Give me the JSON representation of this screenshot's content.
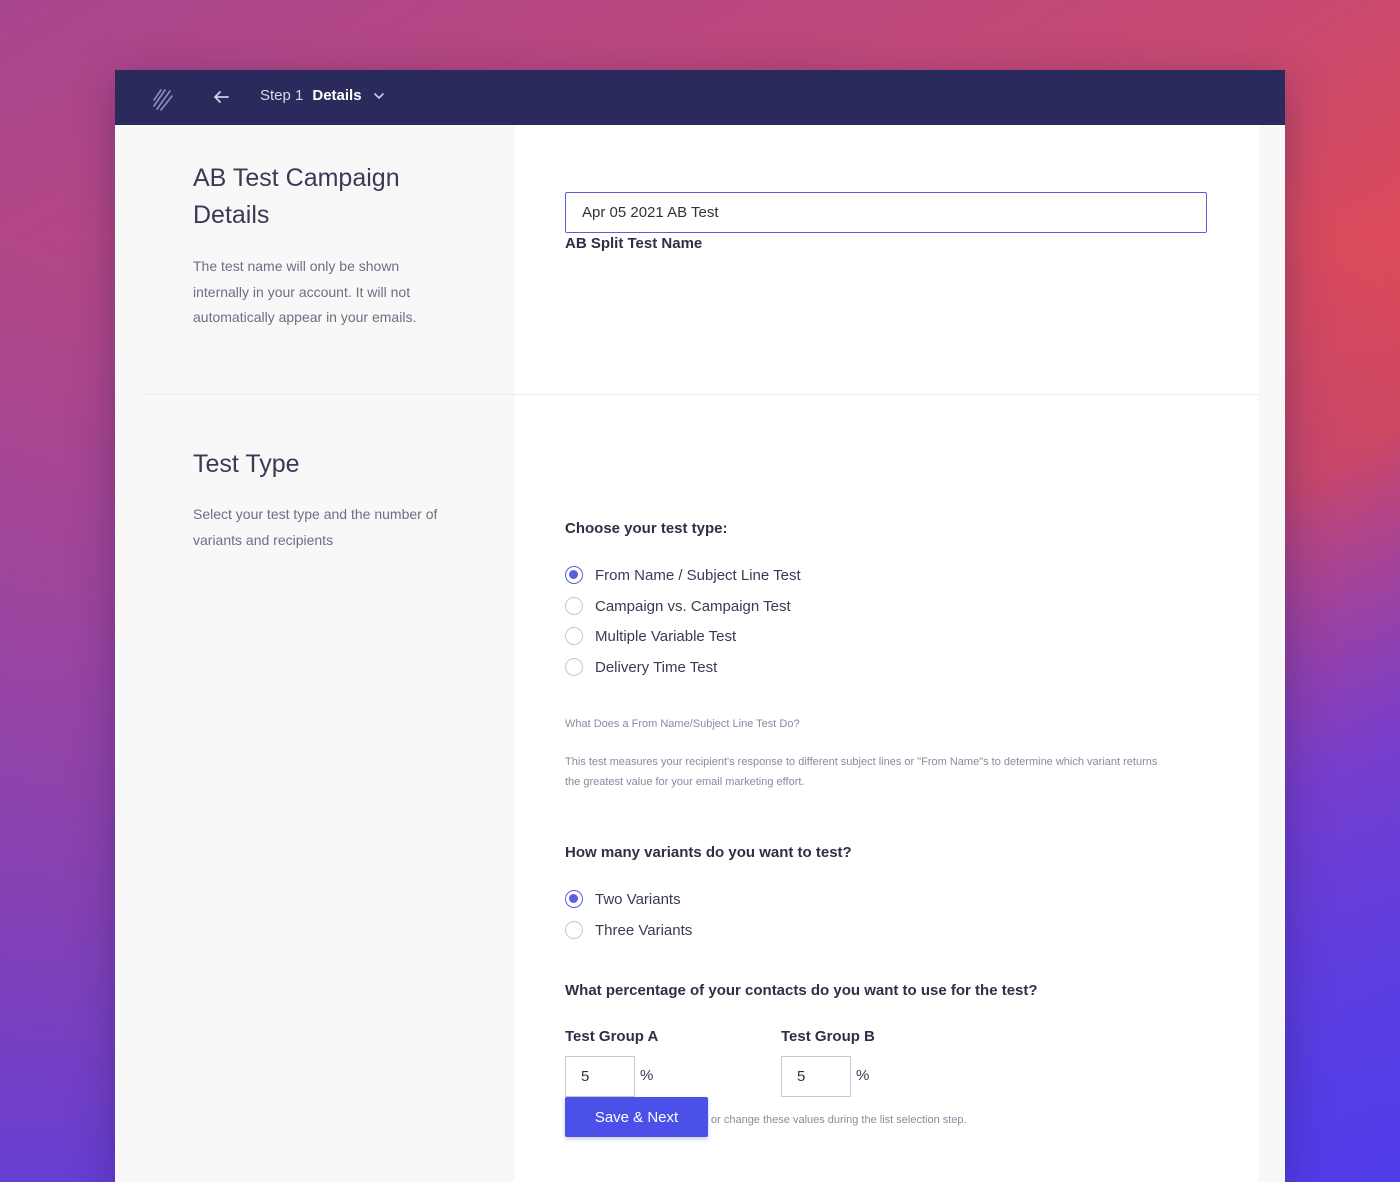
{
  "topbar": {
    "step_label": "Step 1",
    "current_step": "Details"
  },
  "details": {
    "title_line1": "AB Test Campaign",
    "title_line2": "Details",
    "description_line1": "The test name will only be shown",
    "description_line2": "internally in your account. It will not",
    "description_line3": "automatically appear in your emails.",
    "name_label": "AB Split Test Name",
    "name_value": "Apr 05 2021 AB Test"
  },
  "test_type": {
    "title": "Test Type",
    "description_line1": "Select your test type and the number of",
    "description_line2": "variants and recipients",
    "choose_label": "Choose your test type:",
    "options": [
      {
        "label": "From Name / Subject Line Test",
        "checked": true
      },
      {
        "label": "Campaign vs. Campaign Test",
        "checked": false
      },
      {
        "label": "Multiple Variable Test",
        "checked": false
      },
      {
        "label": "Delivery Time Test",
        "checked": false
      }
    ],
    "help_title": "What Does a From Name/Subject Line Test Do?",
    "help_text_line1": "This test measures your recipient's response to different subject lines or \"From Name\"s to determine which variant returns",
    "help_text_line2": "the greatest value for your email marketing effort.",
    "variants_label": "How many variants do you want to test?",
    "variants": [
      {
        "label": "Two Variants",
        "checked": true
      },
      {
        "label": "Three Variants",
        "checked": false
      }
    ],
    "percentage_label": "What percentage of your contacts do you want to use for the test?",
    "group_a_label": "Test Group A",
    "group_a_value": "5",
    "group_b_label": "Test Group B",
    "group_b_value": "5",
    "percent_symbol": "%",
    "note": "You'll get a chance to confirm or change these values during the list selection step."
  },
  "actions": {
    "save_label": "Save & Next"
  },
  "colors": {
    "topbar": "#2b2a5c",
    "accent": "#5b5ee0",
    "button": "#4b50e8"
  }
}
